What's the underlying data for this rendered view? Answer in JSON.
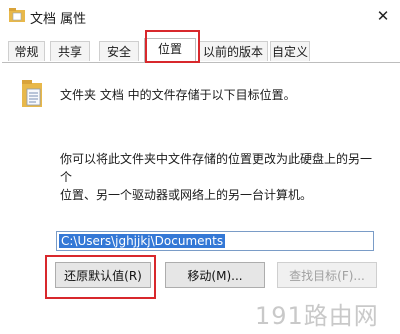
{
  "window": {
    "title": "文档 属性",
    "close_glyph": "✕"
  },
  "tabs": [
    {
      "label": "常规",
      "active": false
    },
    {
      "label": "共享",
      "active": false
    },
    {
      "label": "安全",
      "active": false
    },
    {
      "label": "位置",
      "active": true
    },
    {
      "label": "以前的版本",
      "active": false
    },
    {
      "label": "自定义",
      "active": false
    }
  ],
  "location": {
    "header": "文件夹 文档 中的文件存储于以下目标位置。",
    "description_line1": "你可以将此文件夹中文件存储的位置更改为此硬盘上的另一个",
    "description_line2": "位置、另一个驱动器或网络上的另一台计算机。",
    "path_value": "C:\\Users\\jghjjkj\\Documents"
  },
  "buttons": {
    "restore_default": "还原默认值(R)",
    "move": "移动(M)...",
    "find_target": "查找目标(F)..."
  },
  "watermark": "191路由网",
  "colors": {
    "highlight": "#d8282c",
    "selection": "#3478d6",
    "folder": "#e8b84a"
  }
}
